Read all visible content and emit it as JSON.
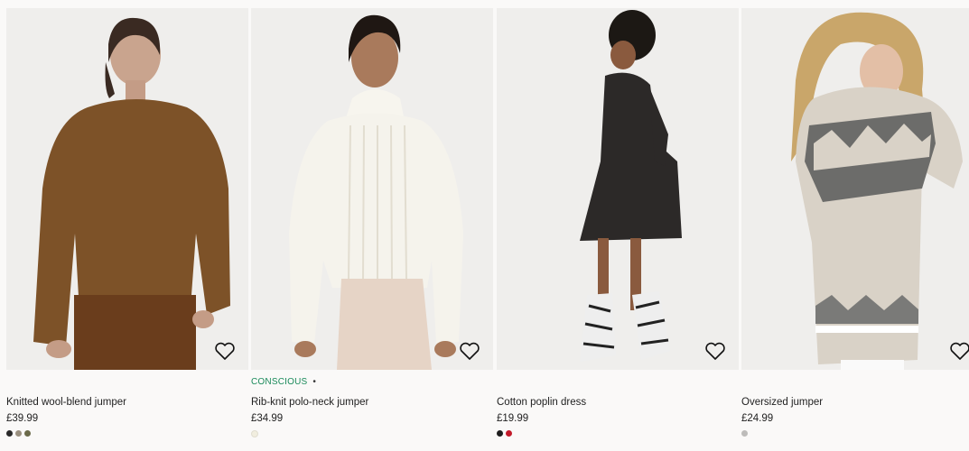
{
  "products": [
    {
      "tag": "",
      "title": "Knitted wool-blend jumper",
      "price": "£39.99",
      "swatches": [
        "#2a2a2a",
        "#9a9080",
        "#6b6a4a"
      ],
      "favorite_icon": "heart-outline-icon"
    },
    {
      "tag": "CONSCIOUS",
      "tag_dot": "•",
      "title": "Rib-knit polo-neck jumper",
      "price": "£34.99",
      "swatches": [
        "#f1eedf"
      ],
      "favorite_icon": "heart-outline-icon"
    },
    {
      "tag": "",
      "title": "Cotton poplin dress",
      "price": "£19.99",
      "swatches": [
        "#1e1e1e",
        "#c21a2a"
      ],
      "favorite_icon": "heart-outline-icon"
    },
    {
      "tag": "",
      "title": "Oversized jumper",
      "price": "£24.99",
      "swatches": [
        "#bdbcba"
      ],
      "favorite_icon": "heart-outline-icon"
    }
  ]
}
